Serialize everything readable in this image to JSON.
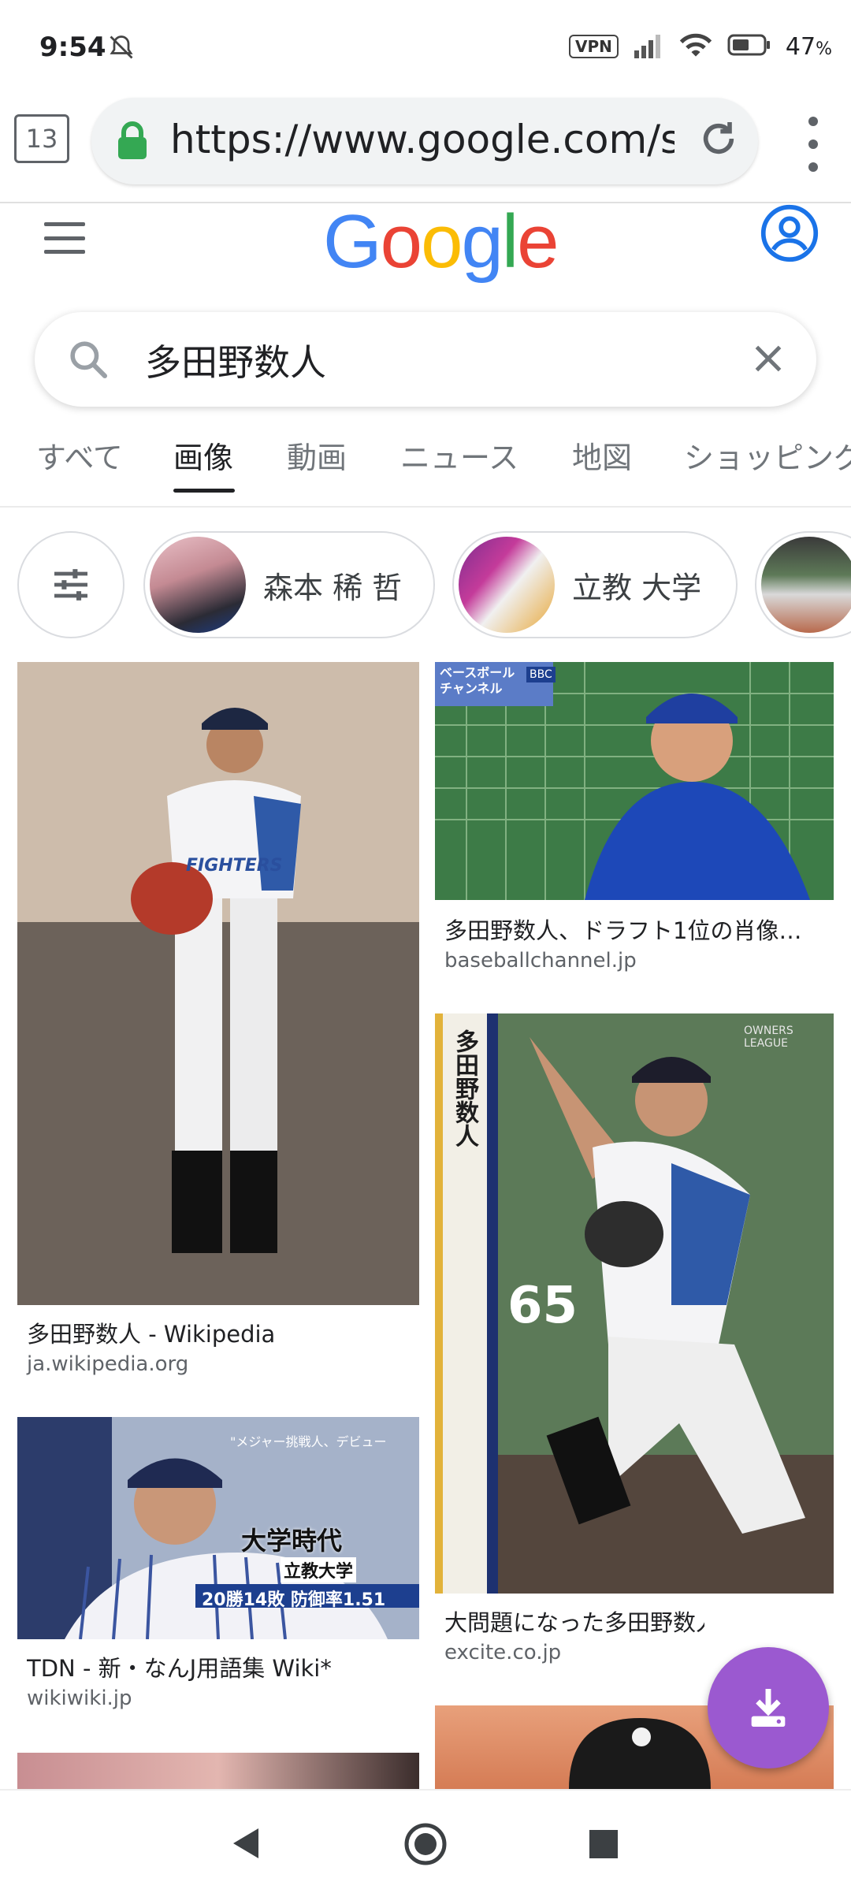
{
  "status_bar": {
    "time": "9:54",
    "vpn_label": "VPN",
    "battery_percent": "47",
    "battery_unit": "%"
  },
  "browser": {
    "tab_count": "13",
    "url": "https://www.google.com/sea",
    "icons": [
      "lock-icon",
      "reload-icon",
      "more-vert-icon"
    ]
  },
  "google_header": {
    "logo_letters": [
      "G",
      "o",
      "o",
      "g",
      "l",
      "e"
    ],
    "logo_colors": [
      "#4285F4",
      "#EA4335",
      "#FBBC05",
      "#4285F4",
      "#34A853",
      "#EA4335"
    ]
  },
  "search": {
    "query": "多田野数人"
  },
  "tabs": [
    {
      "label": "すべて",
      "active": false
    },
    {
      "label": "画像",
      "active": true
    },
    {
      "label": "動画",
      "active": false
    },
    {
      "label": "ニュース",
      "active": false
    },
    {
      "label": "地図",
      "active": false
    },
    {
      "label": "ショッピング",
      "active": false
    }
  ],
  "chips": [
    {
      "label": "森本 稀 哲"
    },
    {
      "label": "立教 大学"
    }
  ],
  "results": [
    {
      "title": "多田野数人 - Wikipedia",
      "site": "ja.wikipedia.org"
    },
    {
      "title": "TDN - 新・なんJ用語集 Wiki*",
      "site": "wikiwiki.jp"
    },
    {
      "title": "多田野数人、ドラフト1位の肖像…",
      "site": "baseballchannel.jp"
    },
    {
      "title": "大問題になった多田野数人の\"ビ…",
      "site": "excite.co.jp"
    }
  ],
  "image_overlays": {
    "r1_jersey": "FIGHTERS",
    "r2_banner_top": "\"メジャー挑戦人、デビュー",
    "r2_banner_main": "大学時代",
    "r2_banner_sub": "立教大学",
    "r2_banner_stats": "20勝14敗 防御率1.51",
    "r3_banner": "ベースボール\nチャンネル",
    "r3_logo": "BBC",
    "r4_name": "多田野数人",
    "r4_number": "65",
    "r4_brand": "OWNERS LEAGUE"
  },
  "colors": {
    "accent": "#1a73e8",
    "fab": "#9b59d0",
    "lock": "#34A853"
  }
}
